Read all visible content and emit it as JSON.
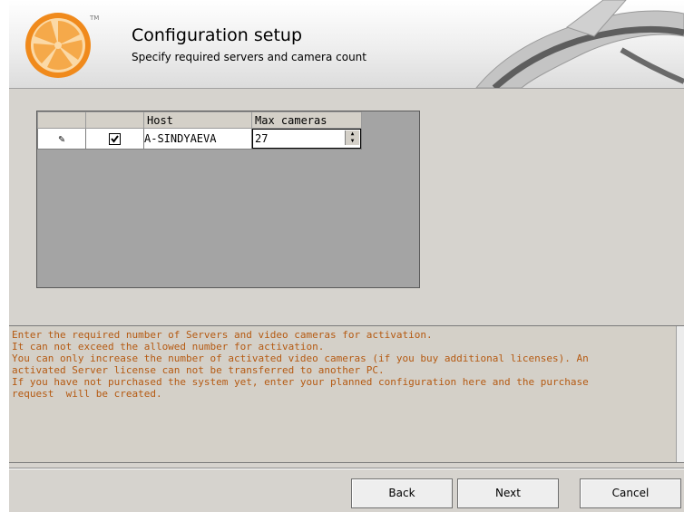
{
  "header": {
    "title": "Configuration setup",
    "subtitle": "Specify required servers and camera count",
    "logo_text": "TM"
  },
  "grid": {
    "columns": [
      "",
      "",
      "Host",
      "Max cameras"
    ],
    "rows": [
      {
        "edit_icon": "pencil-icon",
        "checked": true,
        "host": "A-SINDYAEVA",
        "max_cameras": "27"
      }
    ]
  },
  "info": {
    "lines": [
      "Enter the required number of Servers and video cameras for activation.",
      "It can not exceed the allowed number for activation.",
      "You can only increase the number of activated video cameras (if you buy additional licenses). An",
      "activated Server license can not be transferred to another PC.",
      "If you have not purchased the system yet, enter your planned configuration here and the purchase",
      "request  will be created."
    ]
  },
  "buttons": {
    "back": "Back",
    "next": "Next",
    "cancel": "Cancel"
  },
  "colors": {
    "info_text": "#b55a12",
    "logo_orange": "#f08a1c",
    "grid_bg": "#a4a4a4"
  }
}
